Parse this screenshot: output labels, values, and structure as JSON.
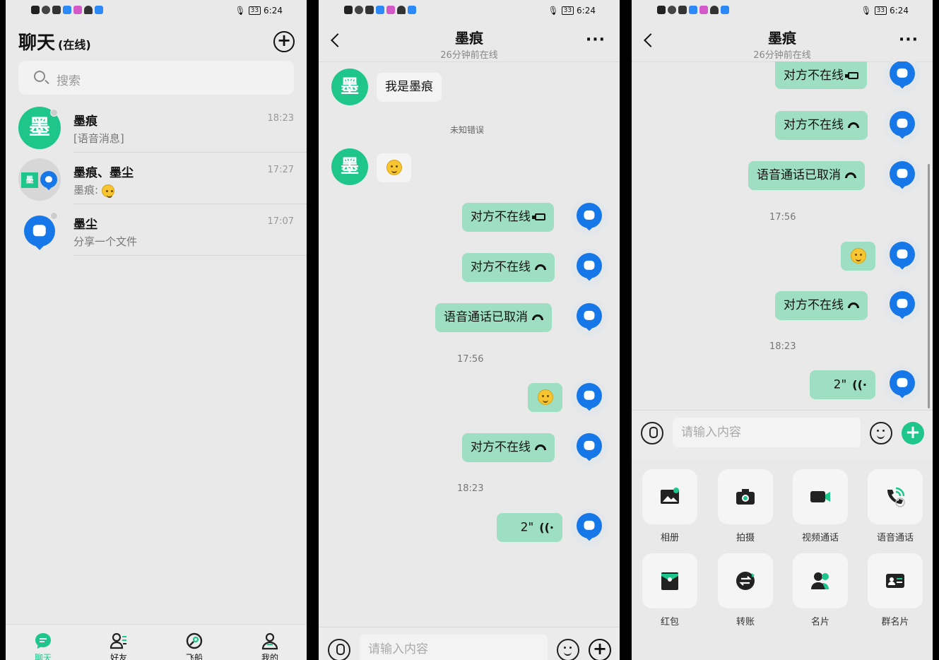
{
  "status": {
    "battery": "33",
    "time": "6:24"
  },
  "chat_list": {
    "title": "聊天",
    "title_suffix": "(在线)",
    "search_placeholder": "搜索",
    "items": [
      {
        "name": "墨痕",
        "time": "18:23",
        "message": "[语音消息]",
        "avatar_text": "墨"
      },
      {
        "name": "墨痕、墨尘",
        "time": "17:27",
        "message": "墨痕: ",
        "avatar_text": "墨"
      },
      {
        "name": "墨尘",
        "time": "17:07",
        "message": "分享一个文件"
      }
    ],
    "tabs": [
      {
        "label": "聊天"
      },
      {
        "label": "好友"
      },
      {
        "label": "飞船"
      },
      {
        "label": "我的"
      }
    ],
    "active_color": "#1ec68b"
  },
  "chat": {
    "title": "墨痕",
    "subtitle": "26分钟前在线",
    "avatar_text": "墨",
    "incoming_text": "我是墨痕",
    "system_msg": "未知错误",
    "msg_offline": "对方不在线",
    "msg_cancelled": "语音通话已取消",
    "ts1": "17:56",
    "ts2": "18:23",
    "voice_len": "2\"",
    "input_placeholder": "请输入内容"
  },
  "tools": [
    {
      "label": "相册",
      "icon": "photo-album-icon"
    },
    {
      "label": "拍摄",
      "icon": "camera-icon"
    },
    {
      "label": "视频通话",
      "icon": "video-call-icon"
    },
    {
      "label": "语音通话",
      "icon": "voice-call-icon"
    },
    {
      "label": "红包",
      "icon": "red-packet-icon"
    },
    {
      "label": "转账",
      "icon": "transfer-icon"
    },
    {
      "label": "名片",
      "icon": "contact-card-icon"
    },
    {
      "label": "群名片",
      "icon": "group-card-icon"
    }
  ]
}
